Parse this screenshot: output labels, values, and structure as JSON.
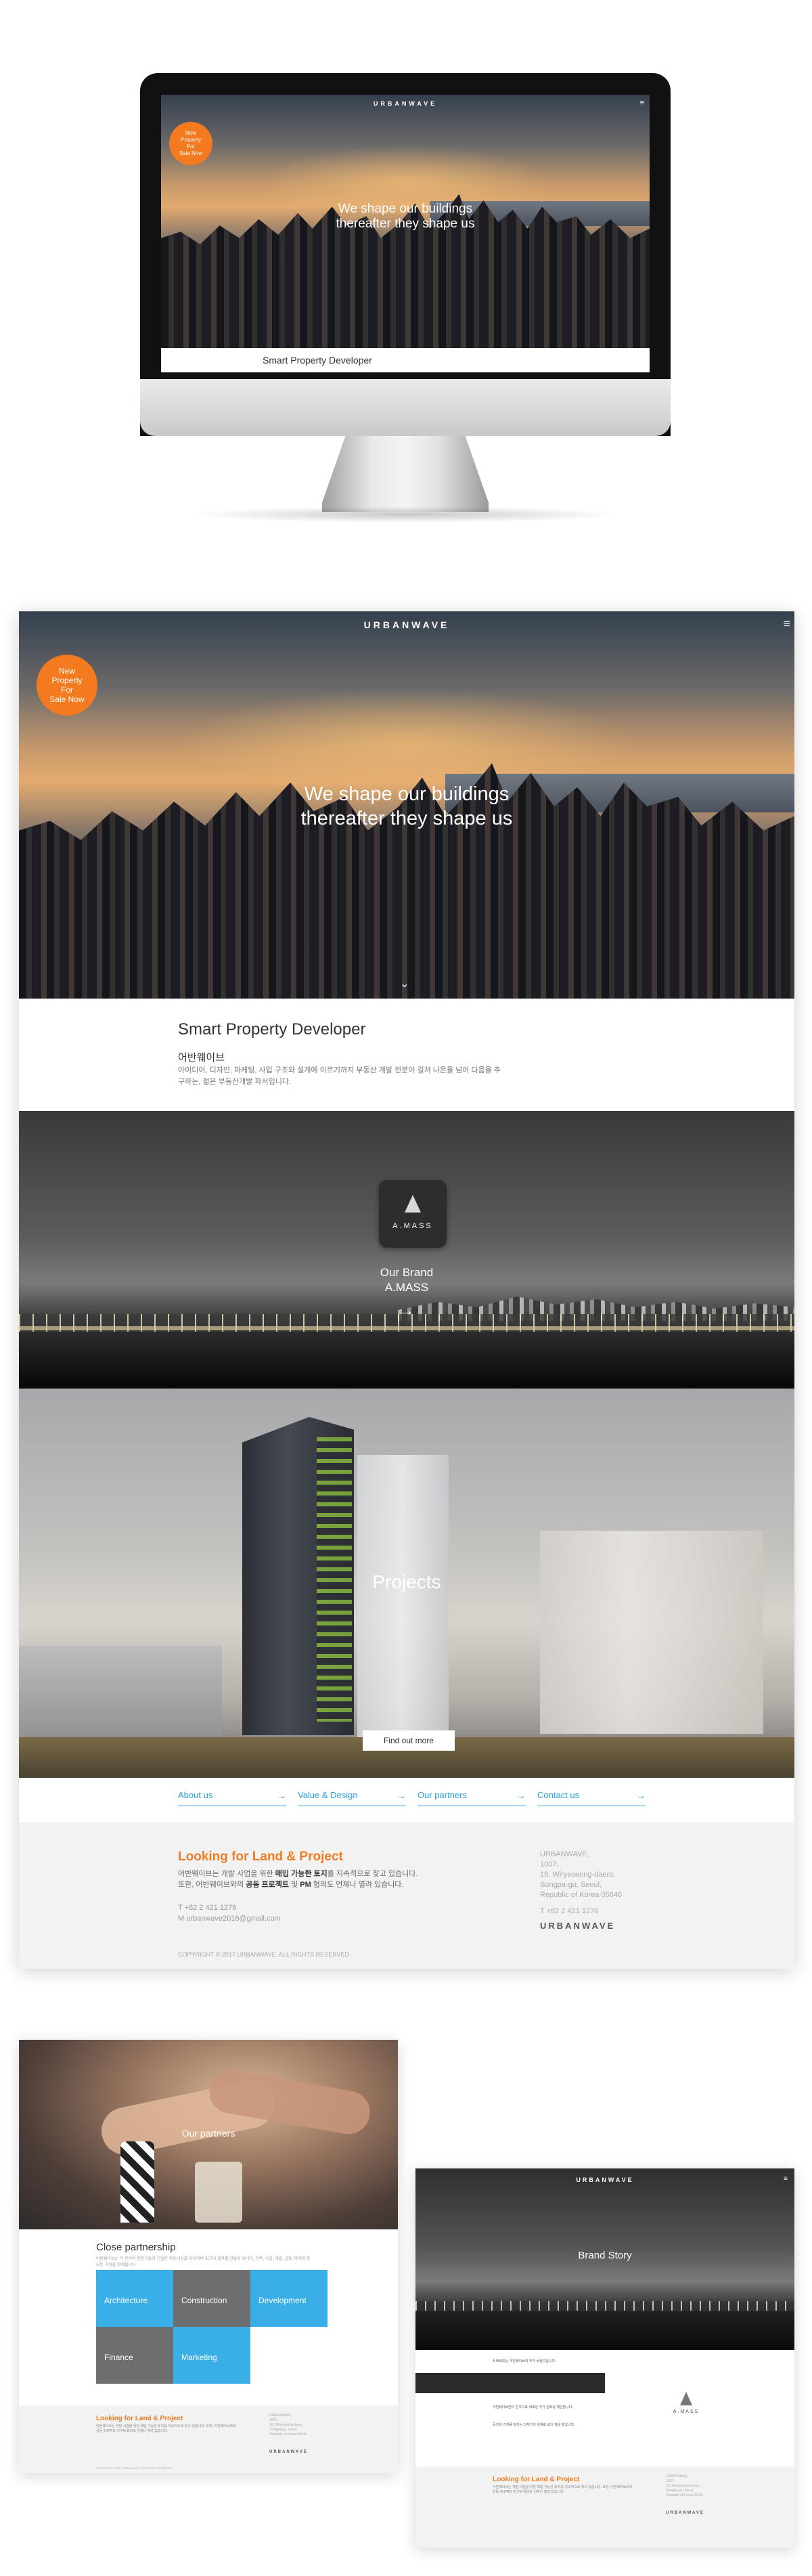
{
  "brand": {
    "logo": "URBANWAVE",
    "menu_icon": "menu-icon"
  },
  "hero": {
    "badge": "New\nProperty\nFor\nSale Now",
    "headline_line1": "We shape our buildings",
    "headline_line2": "thereafter they shape us",
    "scroll_icon": "chevron-down-icon"
  },
  "imac": {
    "tagline": "Smart Property Developer"
  },
  "intro": {
    "title": "Smart Property Developer",
    "subtitle": "어반웨이브",
    "description": "아이디어, 디자인, 마케팅, 사업 구조와 설계에 이르기까지 부동산 개발 전분야 걸쳐 나온을 넘어 다음을 추구하는, 젊은 부동산개발 파서입니다."
  },
  "our_brand": {
    "brand_word": "A.MASS",
    "caption_line1": "Our Brand",
    "caption_line2": "A.MASS",
    "arrow": "→"
  },
  "projects": {
    "title": "Projects",
    "button": "Find out more"
  },
  "quicklinks": [
    {
      "label": "About us",
      "arrow": "→"
    },
    {
      "label": "Value & Design",
      "arrow": "→"
    },
    {
      "label": "Our partners",
      "arrow": "→"
    },
    {
      "label": "Contact us",
      "arrow": "→"
    }
  ],
  "footer": {
    "title": "Looking for Land & Project",
    "desc_line1_a": "어반웨이브는 개발 사업을 위한 ",
    "desc_line1_b": "매입 가능한 토지",
    "desc_line1_c": "를 지속적으로 찾고 있습니다.",
    "desc_line2_a": "또한, 어반웨이브와의 ",
    "desc_line2_b": "공동 프로젝트",
    "desc_line2_c": " 및 ",
    "desc_line2_d": "PM",
    "desc_line2_e": " 협의도 언제나 열려 있습니다.",
    "phone": "T +82 2 421 1276",
    "email": "M urbanwave2016@gmail.com",
    "address": "URBANWAVE,\n1007,\n18, Wiryeseong-daero,\nSongpa-gu, Seoul,\nRepublic of Korea 05646",
    "address_phone": "T +82 2 421 1276",
    "logo": "URBANWAVE",
    "copyright": "COPYRIGHT © 2017 URBANWAVE. ALL RIGHTS RESERVED."
  },
  "partners_page": {
    "hero_title": "Our partners",
    "close_title": "Close partnership",
    "close_desc": "어반웨이브는 각 분야의 전문가들과 긴밀한 파트너십을 유지하며 최고의 결과를 만들어 냅니다. 건축, 시공, 개발, 금융, 마케팅 등 모든 과정을 함께합니다.",
    "tiles": [
      {
        "label": "Architecture",
        "color": "#3aaee6"
      },
      {
        "label": "Construction",
        "color": "#6d6e70"
      },
      {
        "label": "Development",
        "color": "#3aaee6"
      },
      {
        "label": "Finance",
        "color": "#6d6e70"
      },
      {
        "label": "Marketing",
        "color": "#3aaee6"
      }
    ],
    "footer_title": "Looking for Land & Project",
    "footer_text": "어반웨이브는 개발 사업을 위한 매입 가능한 토지를 지속적으로 찾고 있습니다. 또한, 어반웨이브와의 공동 프로젝트 및 PM 협의도 언제나 열려 있습니다.",
    "footer_address": "URBANWAVE,\n1007,\n18, Wiryeseong-daero,\nSongpa-gu, Seoul,\nRepublic of Korea 05646",
    "footer_logo": "URBANWAVE",
    "copyright": "COPYRIGHT © 2017 URBANWAVE. ALL RIGHTS RESERVED."
  },
  "story_page": {
    "logo": "URBANWAVE",
    "hero_title": "Brand Story",
    "text1": "A.MASS는 어반웨이브의 주거 브랜드입니다.",
    "text2": "어반웨이브만의 감각으로 새로운 주거 문화를 제안합니다.",
    "text3": "공간의 가치를 높이는 디자인과 설계로 삶의 질을 높입니다.",
    "brand_word": "A.MASS",
    "footer_title": "Looking for Land & Project",
    "footer_text": "어반웨이브는 개발 사업을 위한 매입 가능한 토지를 지속적으로 찾고 있습니다. 또한, 어반웨이브와의 공동 프로젝트 및 PM 협의도 언제나 열려 있습니다.",
    "footer_address": "URBANWAVE,\n1007,\n18, Wiryeseong-daero,\nSongpa-gu, Seoul,\nRepublic of Korea 05646",
    "footer_logo": "URBANWAVE"
  },
  "colors": {
    "accent_orange": "#f47a20",
    "link_blue": "#2aa0dc",
    "tile_blue": "#3aaee6",
    "tile_gray": "#6d6e70"
  }
}
